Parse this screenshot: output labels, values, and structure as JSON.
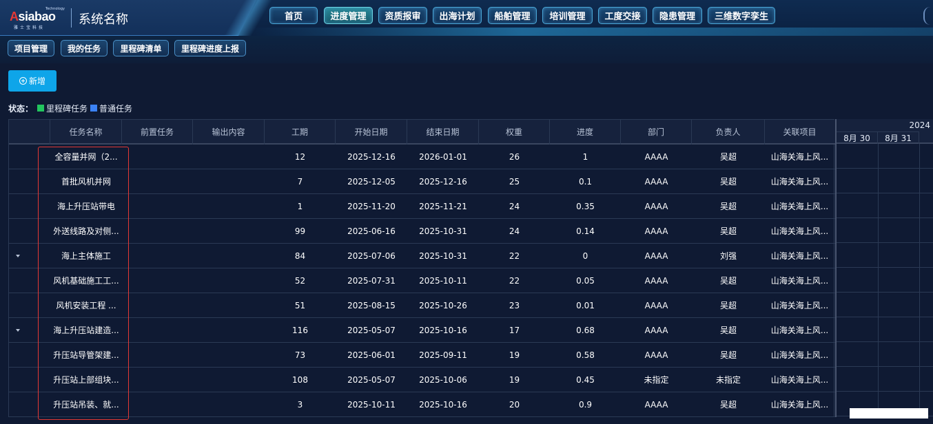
{
  "header": {
    "logo_tagline": "Technology",
    "logo_brand_a": "A",
    "logo_brand_rest": "siabao",
    "logo_sub": "雅士宝科技",
    "system_name": "系统名称",
    "nav": [
      {
        "label": "首页",
        "active": false
      },
      {
        "label": "进度管理",
        "active": true
      },
      {
        "label": "资质报审",
        "active": false
      },
      {
        "label": "出海计划",
        "active": false
      },
      {
        "label": "船舶管理",
        "active": false
      },
      {
        "label": "培训管理",
        "active": false
      },
      {
        "label": "工度交接",
        "active": false
      },
      {
        "label": "隐患管理",
        "active": false
      },
      {
        "label": "三维数字孪生",
        "active": false
      }
    ]
  },
  "subnav": [
    "项目管理",
    "我的任务",
    "里程碑清单",
    "里程碑进度上报"
  ],
  "toolbar": {
    "add_label": "新增"
  },
  "legend": {
    "label": "状态：",
    "items": [
      {
        "label": "里程碑任务",
        "color": "#22c55e"
      },
      {
        "label": "普通任务",
        "color": "#3b82f6"
      }
    ]
  },
  "table": {
    "columns": [
      "",
      "任务名称",
      "前置任务",
      "输出内容",
      "工期",
      "开始日期",
      "结束日期",
      "权重",
      "进度",
      "部门",
      "负责人",
      "关联项目"
    ],
    "rows": [
      {
        "expand": false,
        "name": "全容量并网（2...",
        "pre": "",
        "output": "",
        "duration": "12",
        "start": "2025-12-16",
        "end": "2026-01-01",
        "weight": "26",
        "progress": "1",
        "dept": "AAAA",
        "owner": "吴超",
        "project": "山海关海上风..."
      },
      {
        "expand": false,
        "name": "首批风机并网",
        "pre": "",
        "output": "",
        "duration": "7",
        "start": "2025-12-05",
        "end": "2025-12-16",
        "weight": "25",
        "progress": "0.1",
        "dept": "AAAA",
        "owner": "吴超",
        "project": "山海关海上风..."
      },
      {
        "expand": false,
        "name": "海上升压站带电",
        "pre": "",
        "output": "",
        "duration": "1",
        "start": "2025-11-20",
        "end": "2025-11-21",
        "weight": "24",
        "progress": "0.35",
        "dept": "AAAA",
        "owner": "吴超",
        "project": "山海关海上风..."
      },
      {
        "expand": false,
        "name": "外送线路及对侧...",
        "pre": "",
        "output": "",
        "duration": "99",
        "start": "2025-06-16",
        "end": "2025-10-31",
        "weight": "24",
        "progress": "0.14",
        "dept": "AAAA",
        "owner": "吴超",
        "project": "山海关海上风..."
      },
      {
        "expand": true,
        "name": "海上主体施工",
        "pre": "",
        "output": "",
        "duration": "84",
        "start": "2025-07-06",
        "end": "2025-10-31",
        "weight": "22",
        "progress": "0",
        "dept": "AAAA",
        "owner": "刘强",
        "project": "山海关海上风..."
      },
      {
        "expand": false,
        "name": "风机基础施工工...",
        "pre": "",
        "output": "",
        "duration": "52",
        "start": "2025-07-31",
        "end": "2025-10-11",
        "weight": "22",
        "progress": "0.05",
        "dept": "AAAA",
        "owner": "吴超",
        "project": "山海关海上风..."
      },
      {
        "expand": false,
        "name": "风机安装工程 ...",
        "pre": "",
        "output": "",
        "duration": "51",
        "start": "2025-08-15",
        "end": "2025-10-26",
        "weight": "23",
        "progress": "0.01",
        "dept": "AAAA",
        "owner": "吴超",
        "project": "山海关海上风..."
      },
      {
        "expand": true,
        "name": "海上升压站建造...",
        "pre": "",
        "output": "",
        "duration": "116",
        "start": "2025-05-07",
        "end": "2025-10-16",
        "weight": "17",
        "progress": "0.68",
        "dept": "AAAA",
        "owner": "吴超",
        "project": "山海关海上风..."
      },
      {
        "expand": false,
        "name": "升压站导管架建...",
        "pre": "",
        "output": "",
        "duration": "73",
        "start": "2025-06-01",
        "end": "2025-09-11",
        "weight": "19",
        "progress": "0.58",
        "dept": "AAAA",
        "owner": "吴超",
        "project": "山海关海上风..."
      },
      {
        "expand": false,
        "name": "升压站上部组块...",
        "pre": "",
        "output": "",
        "duration": "108",
        "start": "2025-05-07",
        "end": "2025-10-06",
        "weight": "19",
        "progress": "0.45",
        "dept": "未指定",
        "owner": "未指定",
        "project": "山海关海上风..."
      },
      {
        "expand": false,
        "name": "升压站吊装、就...",
        "pre": "",
        "output": "",
        "duration": "3",
        "start": "2025-10-11",
        "end": "2025-10-16",
        "weight": "20",
        "progress": "0.9",
        "dept": "AAAA",
        "owner": "吴超",
        "project": "山海关海上风..."
      }
    ]
  },
  "gantt": {
    "year": "2024",
    "days": [
      "8月 30",
      "8月 31"
    ]
  }
}
